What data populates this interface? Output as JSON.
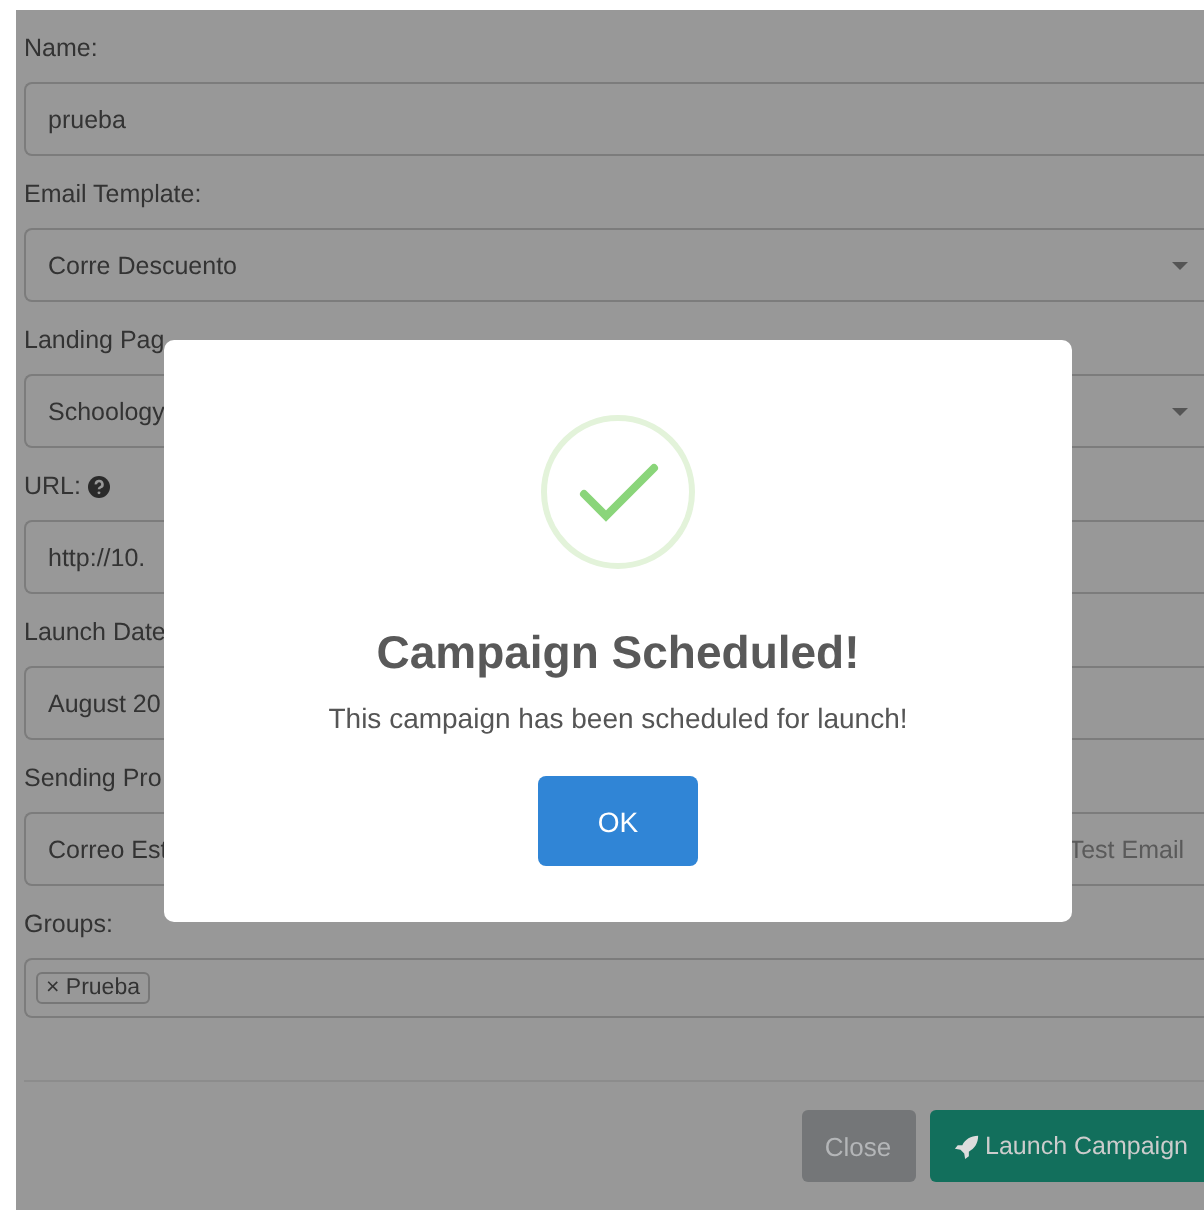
{
  "form": {
    "fields": [
      {
        "label": "Name:",
        "value": "prueba",
        "kind": "text"
      },
      {
        "label": "Email Template:",
        "value": "Corre Descuento",
        "kind": "select"
      },
      {
        "label": "Landing Pag",
        "value": "Schoology",
        "kind": "select"
      },
      {
        "label": "URL:",
        "value": "http://10.",
        "kind": "help"
      },
      {
        "label": "Launch Date",
        "value": "August 20",
        "kind": "text"
      },
      {
        "label": "Sending Pro",
        "value": "Correo Est",
        "kind": "test",
        "button": "Test Email"
      },
      {
        "label": "Groups:",
        "tags": [
          "× Prueba"
        ],
        "kind": "tags"
      }
    ]
  },
  "footer": {
    "close": "Close",
    "launch": "Launch Campaign"
  },
  "dialog": {
    "title": "Campaign Scheduled!",
    "message": "This campaign has been scheduled for launch!",
    "button": "OK"
  }
}
